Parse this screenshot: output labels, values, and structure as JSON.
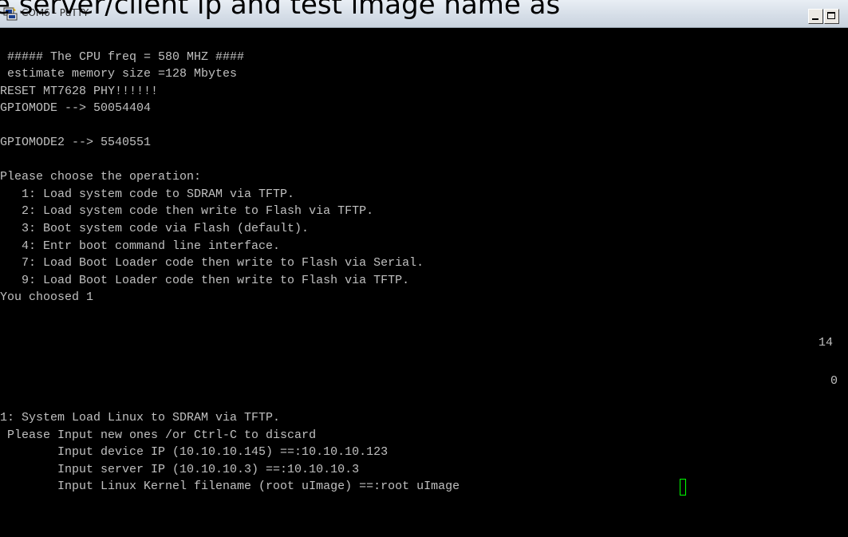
{
  "overlay_caption": "e server/client ip and test image name as",
  "window": {
    "title": "COM6 - PuTTY",
    "icon": "putty-icon"
  },
  "terminal": {
    "lines": [
      " ##### The CPU freq = 580 MHZ ####",
      " estimate memory size =128 Mbytes",
      "RESET MT7628 PHY!!!!!!",
      "GPIOMODE --> 50054404",
      "",
      "GPIOMODE2 --> 5540551",
      "",
      "Please choose the operation:",
      "   1: Load system code to SDRAM via TFTP.",
      "   2: Load system code then write to Flash via TFTP.",
      "   3: Boot system code via Flash (default).",
      "   4: Entr boot command line interface.",
      "   7: Load Boot Loader code then write to Flash via Serial.",
      "   9: Load Boot Loader code then write to Flash via TFTP.",
      "You choosed 1",
      "",
      "",
      "",
      "1: System Load Linux to SDRAM via TFTP.",
      " Please Input new ones /or Ctrl-C to discard",
      "        Input device IP (10.10.10.145) ==:10.10.10.123",
      "        Input server IP (10.10.10.3) ==:10.10.10.3",
      "        Input Linux Kernel filename (root uImage) ==:root uImage"
    ],
    "countdown_top": "14",
    "countdown_bottom": "0"
  }
}
